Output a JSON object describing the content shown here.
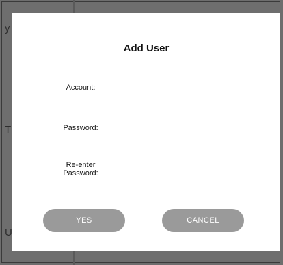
{
  "background": {
    "side_letters": [
      "y",
      "T",
      "U"
    ]
  },
  "dialog": {
    "title": "Add User",
    "fields": [
      {
        "label": "Account:"
      },
      {
        "label": "Password:"
      },
      {
        "label_line1": "Re-enter",
        "label_line2": "Password:"
      }
    ],
    "buttons": {
      "yes": "YES",
      "cancel": "CANCEL"
    }
  },
  "colors": {
    "overlay": "#6e6e6e",
    "dialog_bg": "#ffffff",
    "button_bg": "#9a9a9a",
    "button_text": "#ffffff"
  }
}
